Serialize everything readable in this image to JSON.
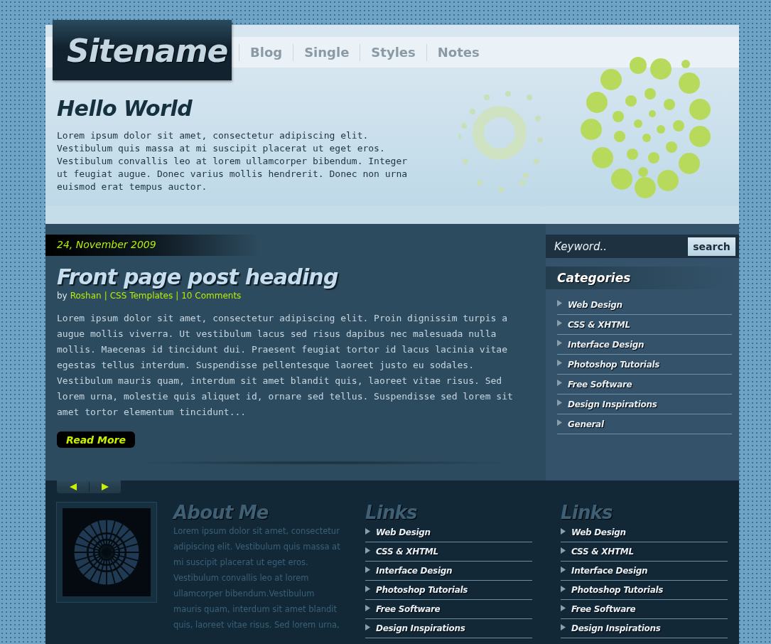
{
  "header": {
    "logo": "Sitename",
    "nav": [
      "Blog",
      "Single",
      "Styles",
      "Notes"
    ],
    "hero": {
      "title": "Hello World",
      "text": "Lorem ipsum dolor sit amet, consectetur adipiscing elit. Vestibulum quis massa at mi suscipit placerat ut eget eros. Vestibulum convallis leo at lorem ullamcorper bibendum. Integer ut feugiat augue. Donec varius mollis hendrerit. Donec non urna euismod erat tempus auctor."
    }
  },
  "post": {
    "date": "24, November 2009",
    "title": "Front page post heading",
    "by": "by",
    "author": "Roshan",
    "separators": [
      "|",
      "|"
    ],
    "category": "CSS Templates",
    "comments": "10 Comments",
    "text": "Lorem ipsum dolor sit amet, consectetur adipiscing elit. Proin dignissim turpis a augue mollis viverra. Ut vestibulum lacus sed risus dapibus nec malesuada nulla mollis. Maecenas id tincidunt dui. Praesent feugiat tortor id lacus lacinia vitae egestas tellus interdum. Suspendisse pellentesque laoreet justo eu sodales. Vestibulum mauris quam, interdum sit amet blandit quis, laoreet vitae risus. Sed lorem urna, molestie quis aliquet id, ornare sed tellus. Suspendisse sed lorem sit amet tortor elementum tincidunt...",
    "read_more": "Read More"
  },
  "sidebar": {
    "search": {
      "placeholder": "Keyword..",
      "button": "search"
    },
    "categories_title": "Categories",
    "categories": [
      "Web Design",
      "CSS & XHTML",
      "Interface Design",
      "Photoshop Tutorials",
      "Free Software",
      "Design Inspirations",
      "General"
    ]
  },
  "footer": {
    "about": {
      "title": "About Me",
      "text": "Lorem ipsum dolor sit amet, consectetur adipiscing elit. Vestibulum quis massa at mi suscipit placerat ut eget eros. Vestibulum convallis leo at lorem ullamcorper bibendum.Vestibulum mauris quam, interdum sit amet blandit quis, laoreet vitae risus. Sed lorem urna,"
    },
    "link_columns": [
      {
        "title": "Links",
        "items": [
          "Web Design",
          "CSS & XHTML",
          "Interface Design",
          "Photoshop Tutorials",
          "Free Software",
          "Design Inspirations"
        ]
      },
      {
        "title": "Links",
        "items": [
          "Web Design",
          "CSS & XHTML",
          "Interface Design",
          "Photoshop Tutorials",
          "Free Software",
          "Design Inspirations"
        ]
      }
    ]
  }
}
